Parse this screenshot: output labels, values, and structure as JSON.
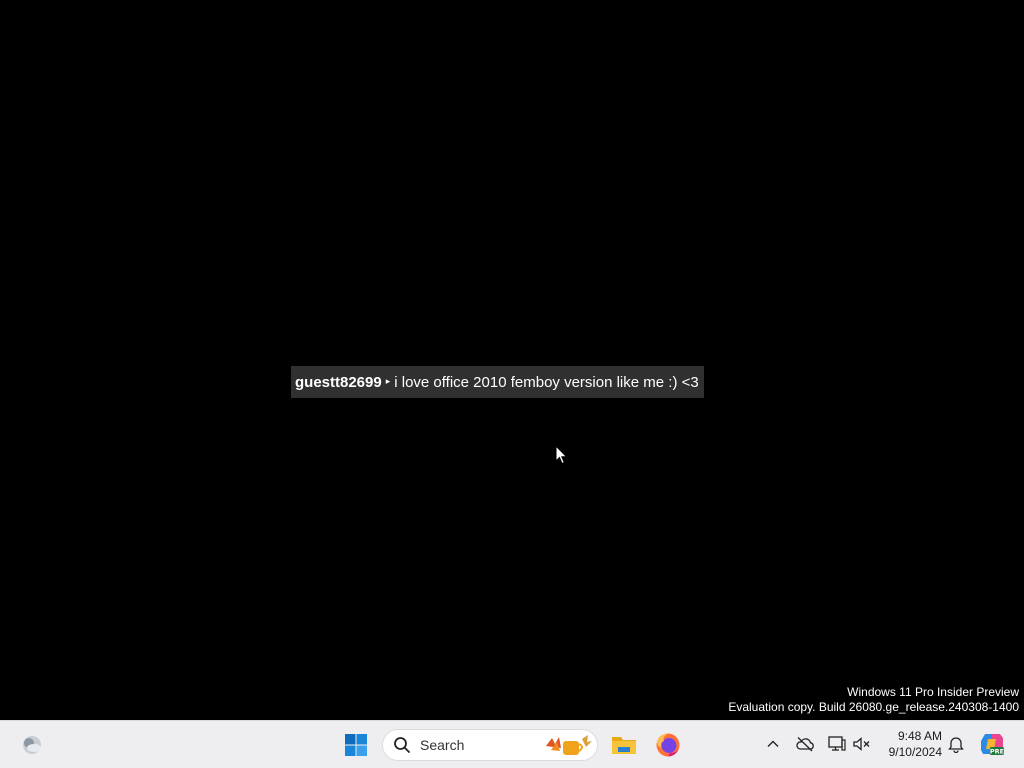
{
  "chat": {
    "username": "guestt82699",
    "arrow": "▸",
    "message": "i love office 2010 femboy version like me :) <3"
  },
  "watermark": {
    "line1": "Windows 11 Pro Insider Preview",
    "line2": "Evaluation copy. Build 26080.ge_release.240308-1400"
  },
  "taskbar": {
    "search_label": "Search",
    "time": "9:48 AM",
    "date": "9/10/2024",
    "copilot_badge": "PRE"
  },
  "colors": {
    "desktop": "#000000",
    "taskbar": "#eeeef0",
    "start_blue": "#0f6cbd",
    "folder_yellow": "#f7c33b",
    "firefox_orange": "#ff7139"
  },
  "icons": [
    "weather-icon",
    "windows-start-icon",
    "search-icon",
    "file-explorer-icon",
    "firefox-icon",
    "chevron-up-icon",
    "onedrive-offline-icon",
    "network-icon",
    "volume-icon",
    "bell-icon",
    "copilot-icon"
  ]
}
